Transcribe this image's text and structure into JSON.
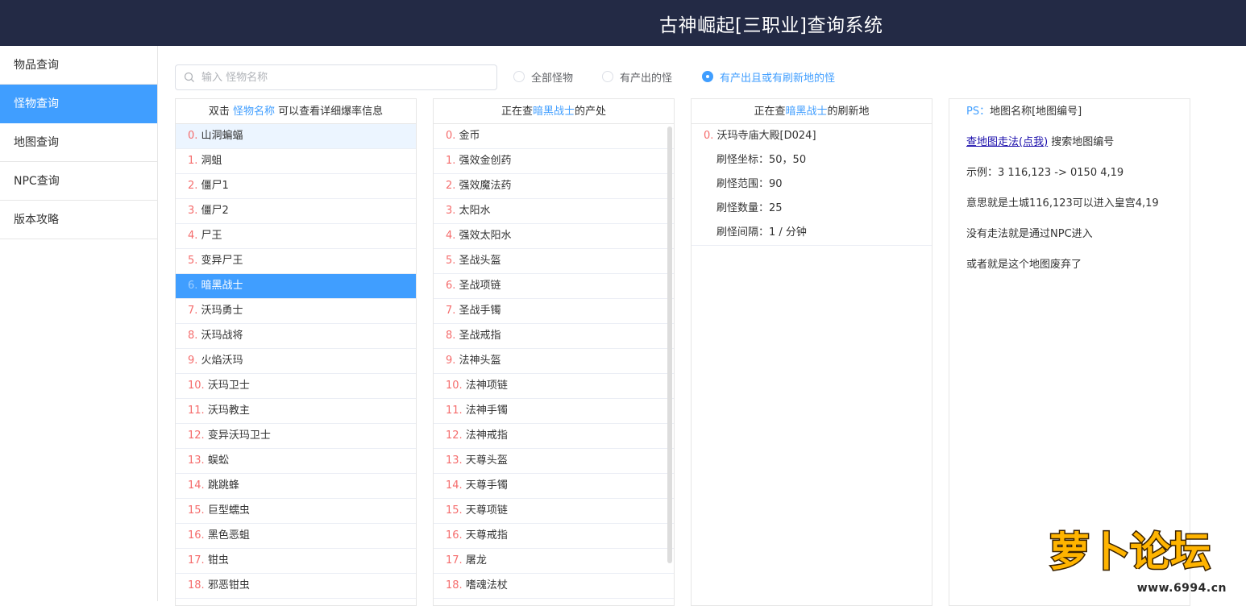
{
  "header": {
    "title": "古神崛起[三职业]查询系统"
  },
  "sidebar": {
    "items": [
      {
        "label": "物品查询"
      },
      {
        "label": "怪物查询"
      },
      {
        "label": "地图查询"
      },
      {
        "label": "NPC查询"
      },
      {
        "label": "版本攻略"
      }
    ],
    "active_index": 1
  },
  "search": {
    "placeholder": "输入 怪物名称",
    "value": ""
  },
  "filters": [
    {
      "label": "全部怪物",
      "checked": false
    },
    {
      "label": "有产出的怪",
      "checked": false
    },
    {
      "label": "有产出且或有刷新地的怪",
      "checked": true
    }
  ],
  "monster_panel": {
    "header_prefix": "双击 ",
    "header_highlight": "怪物名称",
    "header_suffix": " 可以查看详细爆率信息",
    "selected_index": 6,
    "hover_index": 0,
    "rows": [
      "山洞蝙蝠",
      "洞蛆",
      "僵尸1",
      "僵尸2",
      "尸王",
      "变异尸王",
      "暗黑战士",
      "沃玛勇士",
      "沃玛战将",
      "火焰沃玛",
      "沃玛卫士",
      "沃玛教主",
      "变异沃玛卫士",
      "蜈蚣",
      "跳跳蜂",
      "巨型蠕虫",
      "黑色恶蛆",
      "钳虫",
      "邪恶钳虫"
    ]
  },
  "drops_panel": {
    "header_prefix": "正在查",
    "header_highlight": "暗黑战士",
    "header_suffix": "的产处",
    "rows": [
      "金币",
      "强效金创药",
      "强效魔法药",
      "太阳水",
      "强效太阳水",
      "圣战头盔",
      "圣战项链",
      "圣战手镯",
      "圣战戒指",
      "法神头盔",
      "法神项链",
      "法神手镯",
      "法神戒指",
      "天尊头盔",
      "天尊手镯",
      "天尊项链",
      "天尊戒指",
      "屠龙",
      "嗜魂法杖"
    ]
  },
  "spawn_panel": {
    "header_prefix": "正在查",
    "header_highlight": "暗黑战士",
    "header_suffix": "的刷新地",
    "entry_index": "0. ",
    "entry_name": "沃玛寺庙大殿[D024]",
    "details": [
      "刷怪坐标：50，50",
      "刷怪范围：90",
      "刷怪数量：25",
      "刷怪间隔：1 / 分钟"
    ]
  },
  "info_panel": {
    "ps_label": "PS：",
    "ps_text": "地图名称[地图编号]",
    "link_text": "查地图走法(点我)",
    "link_suffix": " 搜索地图编号",
    "lines": [
      "示例：3 116,123 -> 0150 4,19",
      "意思就是土城116,123可以进入皇宫4,19",
      "没有走法就是通过NPC进入",
      "或者就是这个地图废弃了"
    ]
  },
  "watermark": {
    "text": "萝卜论坛",
    "site": "www.6994.cn"
  },
  "colors": {
    "header_bg": "#232a45",
    "accent": "#409eff",
    "index": "#f56c6c"
  }
}
